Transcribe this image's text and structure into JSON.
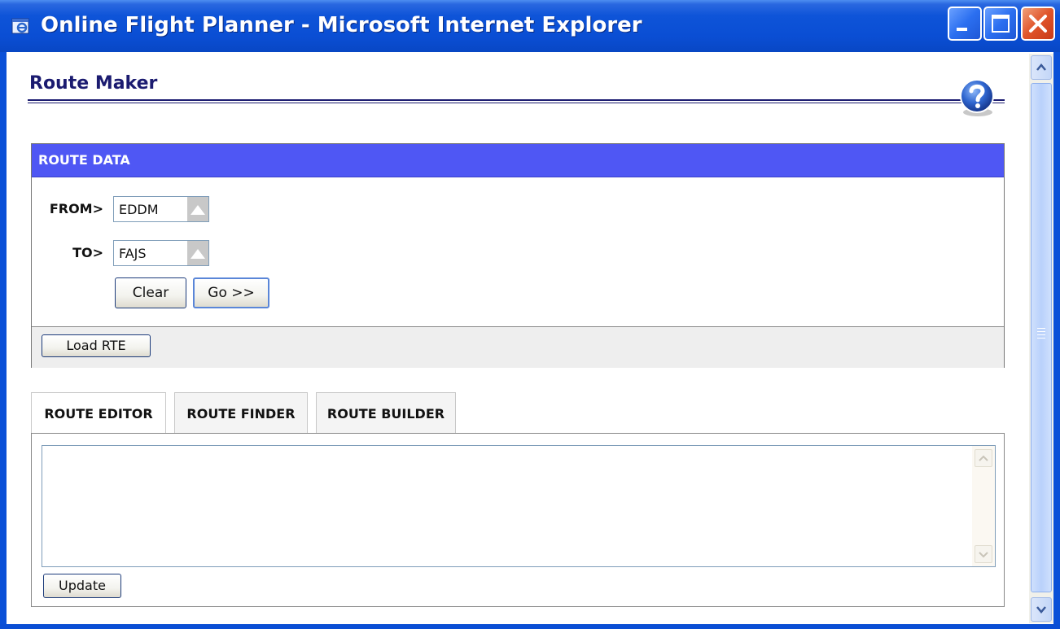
{
  "window": {
    "title": "Online Flight Planner - Microsoft Internet Explorer"
  },
  "page": {
    "heading": "Route Maker"
  },
  "route_data": {
    "header": "ROUTE DATA",
    "from_label": "FROM>",
    "from_value": "EDDM",
    "to_label": "TO>",
    "to_value": "FAJS",
    "clear_label": "Clear",
    "go_label": "Go >>",
    "load_rte_label": "Load RTE"
  },
  "tabs": [
    {
      "label": "ROUTE EDITOR"
    },
    {
      "label": "ROUTE FINDER"
    },
    {
      "label": "ROUTE BUILDER"
    }
  ],
  "editor": {
    "text": "",
    "update_label": "Update"
  },
  "colors": {
    "titlebar": "#0a4ed4",
    "section_header": "#4f57f4",
    "heading_text": "#1b1b70"
  }
}
